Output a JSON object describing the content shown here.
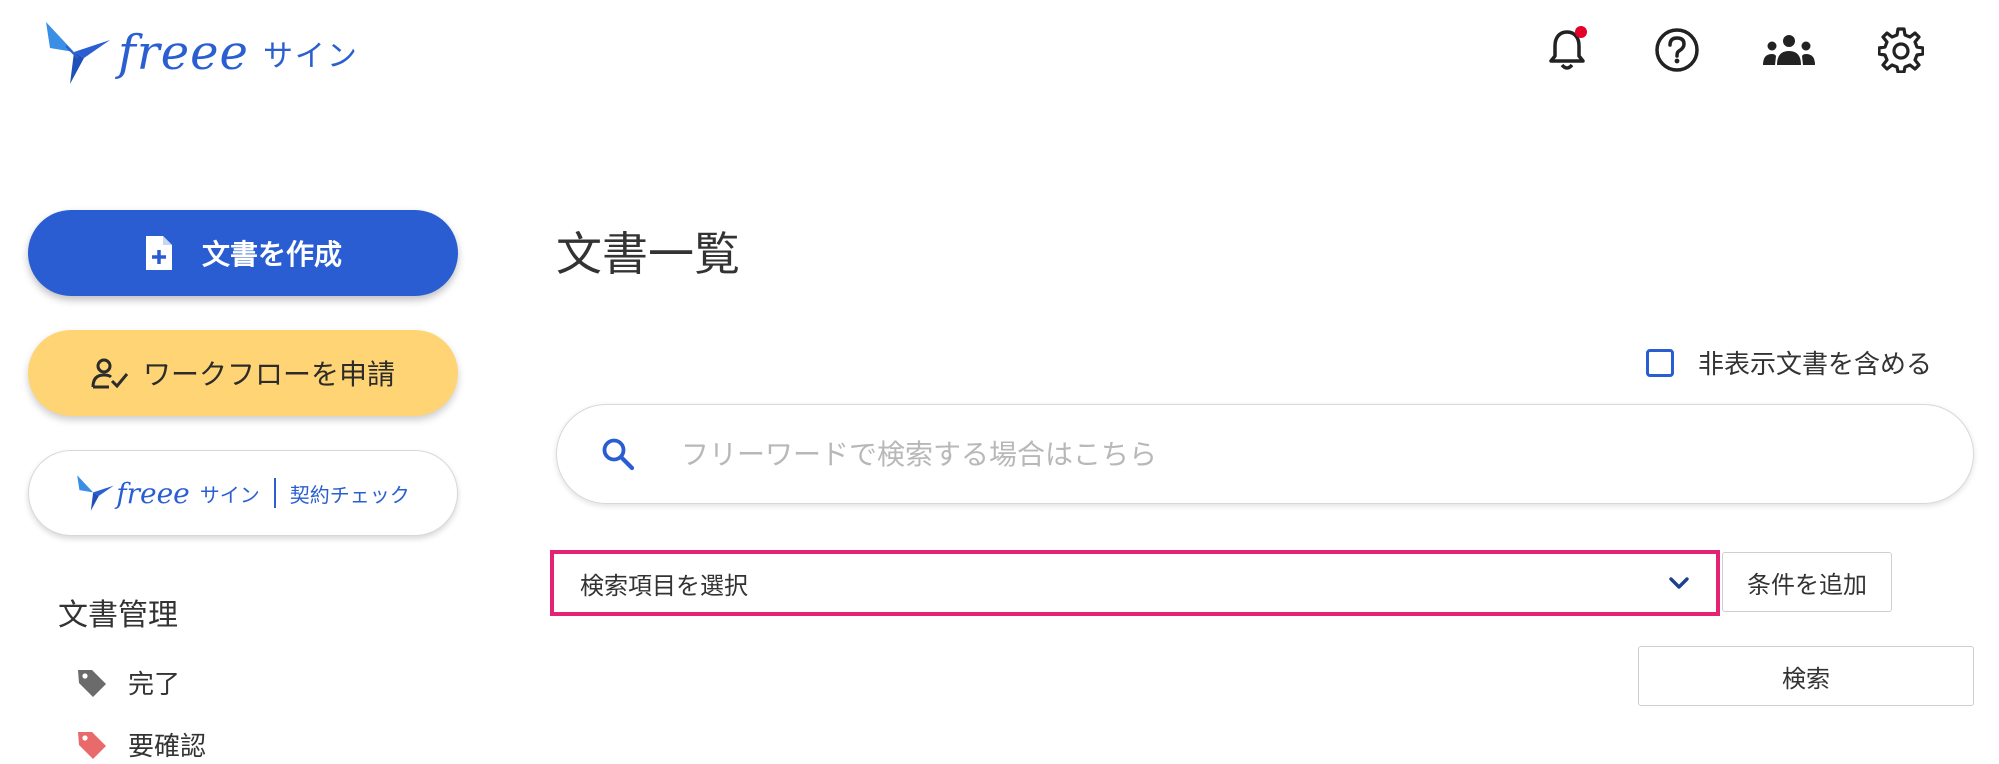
{
  "header": {
    "logo_text": "freee",
    "logo_sub": "サイン",
    "icons": [
      "bell-icon",
      "help-icon",
      "team-icon",
      "gear-icon"
    ],
    "notification_dot_color": "#e5002a"
  },
  "sidebar": {
    "create_button": "文書を作成",
    "workflow_button": "ワークフローを申請",
    "contract_check": {
      "brand": "freee",
      "brand_sub": "サイン",
      "label": "契約チェック"
    },
    "section_title": "文書管理",
    "tags": [
      {
        "label": "完了",
        "color": "#6b6b6b"
      },
      {
        "label": "要確認",
        "color": "#e96a6a"
      }
    ]
  },
  "main": {
    "title": "文書一覧",
    "hidden_toggle_label": "非表示文書を含める",
    "search_placeholder": "フリーワードで検索する場合はこちら",
    "select_field_value": "検索項目を選択",
    "add_condition_label": "条件を追加",
    "search_button_label": "検索"
  },
  "colors": {
    "primary": "#2a5dd1",
    "workflow": "#ffd474",
    "highlight": "#e32474"
  }
}
